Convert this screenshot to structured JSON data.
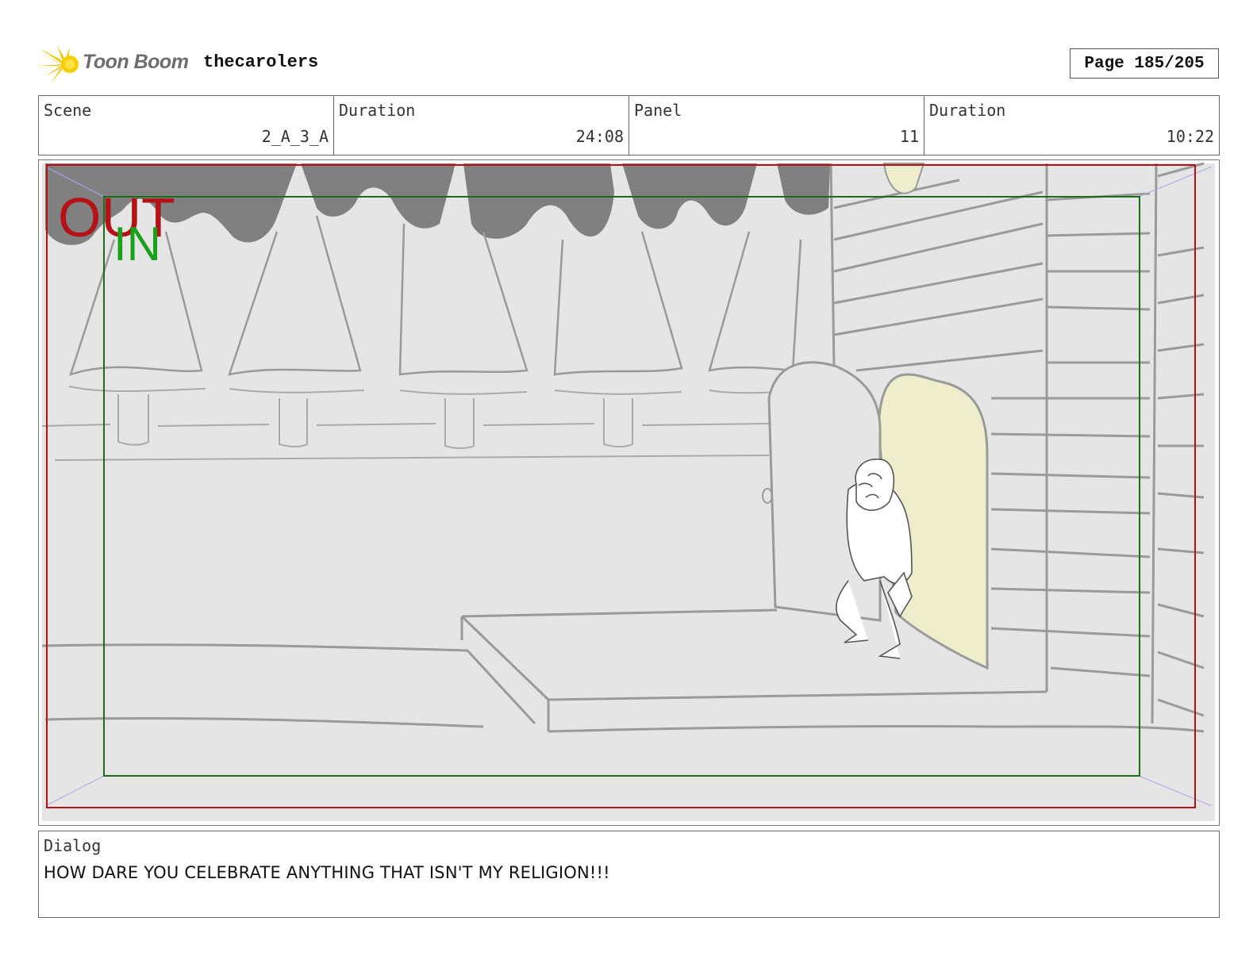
{
  "header": {
    "logo_text": "Toon Boom",
    "project_title": "thecarolers",
    "page_label": "Page 185/205"
  },
  "info": {
    "scene_label": "Scene",
    "scene_value": "2_A_3_A",
    "scene_duration_label": "Duration",
    "scene_duration_value": "24:08",
    "panel_label": "Panel",
    "panel_value": "11",
    "panel_duration_label": "Duration",
    "panel_duration_value": "10:22"
  },
  "frame": {
    "out_label": "OUT",
    "in_label": "IN",
    "out_color": "#b31217",
    "in_color": "#1aa01a"
  },
  "dialog": {
    "label": "Dialog",
    "text": "HOW DARE YOU CELEBRATE ANYTHING THAT ISN'T MY RELIGION!!!"
  },
  "colors": {
    "sketch_bg": "#e5e5e5",
    "sketch_line": "#9a9a9a",
    "awning": "#808080",
    "door_light": "#eeeecc"
  }
}
